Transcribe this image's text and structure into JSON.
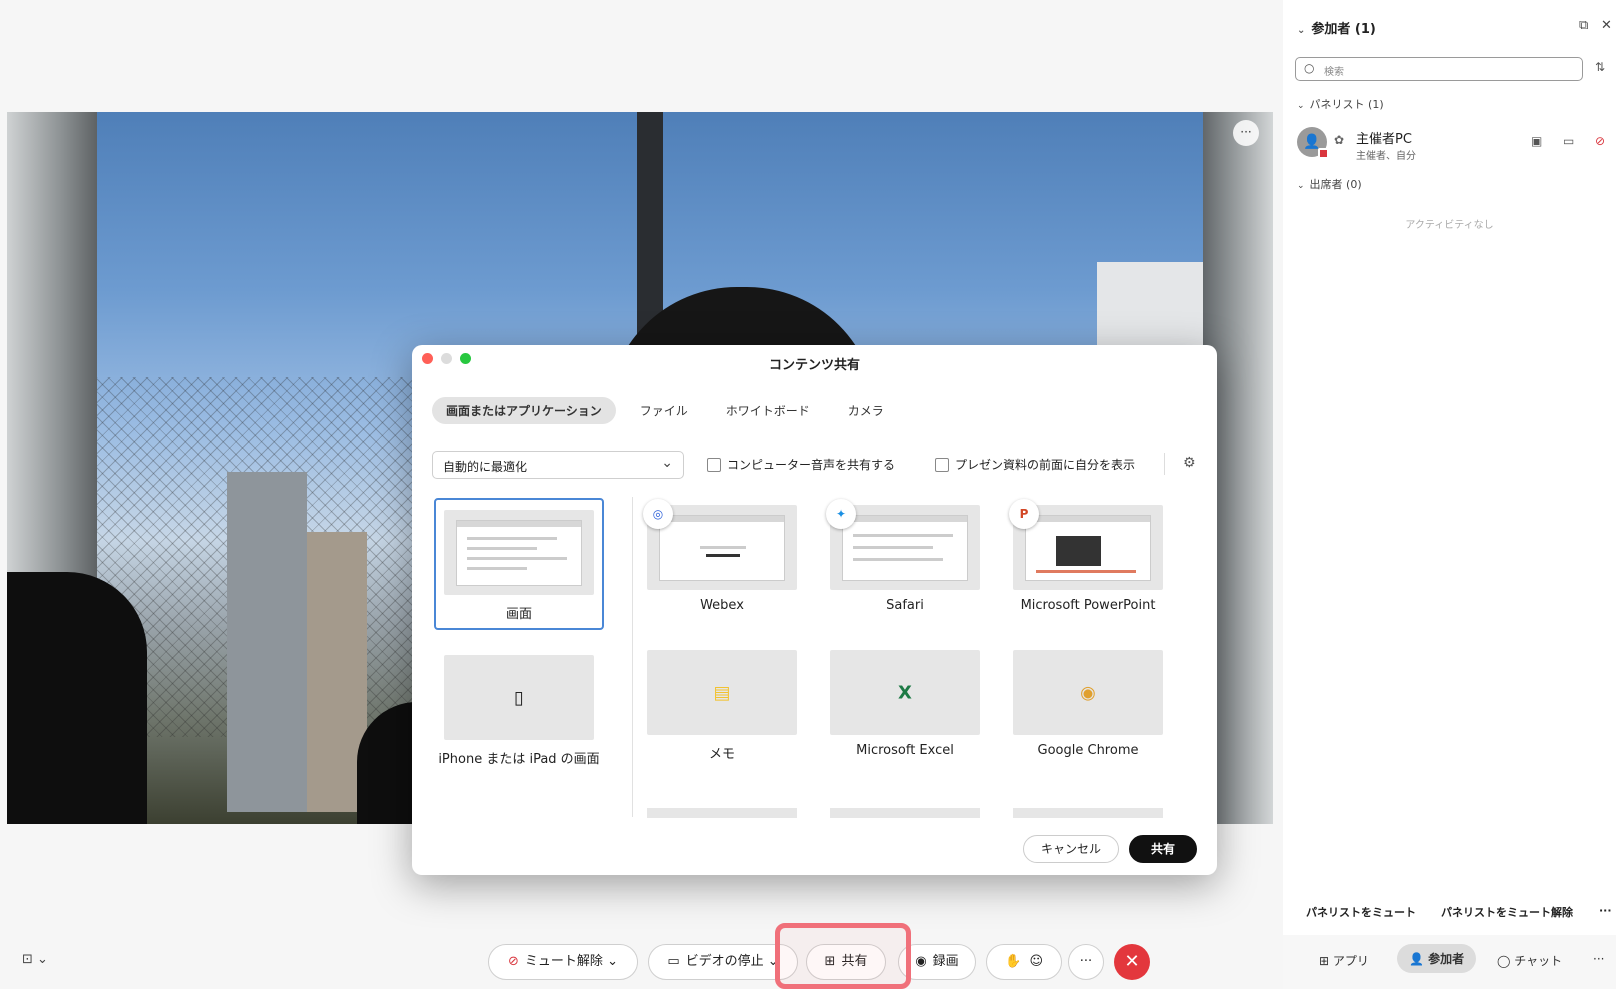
{
  "video": {
    "more": "···"
  },
  "dialog": {
    "title": "コンテンツ共有",
    "tabs": [
      "画面またはアプリケーション",
      "ファイル",
      "ホワイトボード",
      "カメラ"
    ],
    "optimize_select": "自動的に最適化",
    "share_audio": "コンピューター音声を共有する",
    "show_me_in_front": "プレゼン資料の前面に自分を表示",
    "tiles": {
      "screen": "画面",
      "iphone": "iPhone または iPad の画面",
      "webex": "Webex",
      "safari": "Safari",
      "powerpoint": "Microsoft PowerPoint",
      "memo": "メモ",
      "excel": "Microsoft Excel",
      "chrome": "Google Chrome"
    },
    "cancel": "キャンセル",
    "share": "共有"
  },
  "panel": {
    "title": "参加者 (1)",
    "search_placeholder": "検索",
    "panelists": "パネリスト (1)",
    "participant": {
      "name": "主催者PC",
      "role": "主催者、自分"
    },
    "attendees": "出席者 (0)",
    "no_activity": "アクティビティなし",
    "mute_panelists": "パネリストをミュート",
    "unmute_panelists": "パネリストをミュート解除",
    "more": "···",
    "footer": {
      "apps": "アプリ",
      "participants": "参加者",
      "chat": "チャット",
      "more": "···"
    }
  },
  "toolbar": {
    "unmute": "ミュート解除",
    "stop_video": "ビデオの停止",
    "share": "共有",
    "record": "録画",
    "more": "···"
  }
}
